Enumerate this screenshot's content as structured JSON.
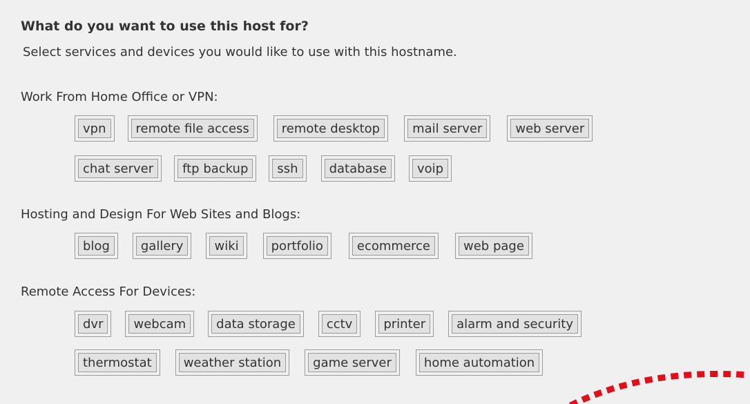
{
  "header": {
    "title": "What do you want to use this host for?",
    "subtitle": "Select services and devices you would like to use with this hostname."
  },
  "sections": [
    {
      "label": "Work From Home Office or VPN:",
      "rows": [
        [
          "vpn",
          "remote file access",
          "remote desktop",
          "mail server",
          "web server"
        ],
        [
          "chat server",
          "ftp backup",
          "ssh",
          "database",
          "voip"
        ]
      ]
    },
    {
      "label": "Hosting and Design For Web Sites and Blogs:",
      "rows": [
        [
          "blog",
          "gallery",
          "wiki",
          "portfolio",
          "ecommerce",
          "web page"
        ]
      ]
    },
    {
      "label": "Remote Access For Devices:",
      "rows": [
        [
          "dvr",
          "webcam",
          "data storage",
          "cctv",
          "printer",
          "alarm and security"
        ],
        [
          "thermostat",
          "weather station",
          "game server",
          "home automation"
        ]
      ]
    }
  ],
  "colors": {
    "background": "#f0f0f0",
    "button_fill": "#e2e2e2",
    "button_border": "#9a9a9a",
    "text": "#333333",
    "accent_dashed": "#e0101a"
  }
}
